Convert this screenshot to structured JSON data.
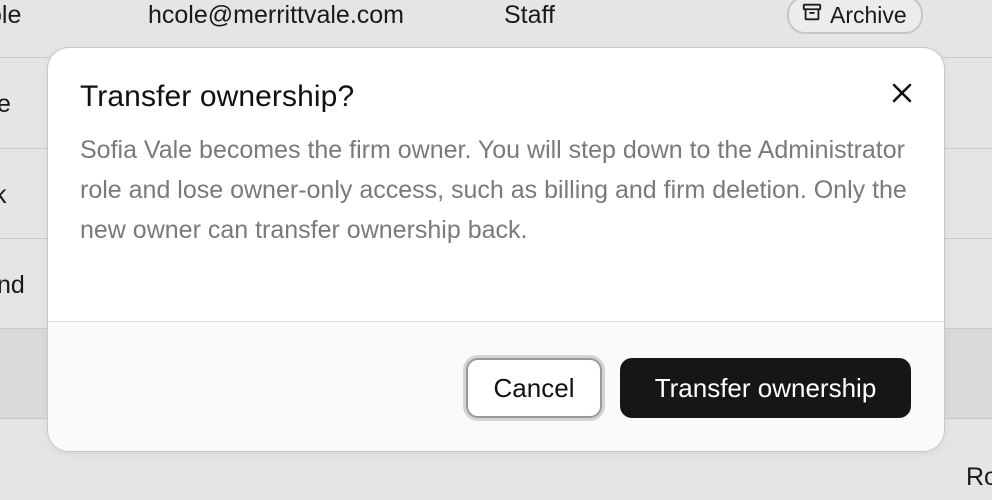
{
  "background_table": {
    "rows": [
      {
        "name_fragment": "ole",
        "email": "hcole@merrittvale.com",
        "role": "Staff",
        "action_label": "Archive"
      },
      {
        "name_fragment": "e"
      },
      {
        "name_fragment": "k"
      },
      {
        "name_fragment": "nd"
      },
      {
        "name_fragment": ""
      },
      {
        "trailing_fragment": "Ro"
      }
    ]
  },
  "dialog": {
    "title": "Transfer ownership?",
    "body": "Sofia Vale becomes the firm owner. You will step down to the Administrator role and lose owner-only access, such as billing and firm deletion. Only the new owner can transfer ownership back.",
    "cancel_label": "Cancel",
    "confirm_label": "Transfer ownership"
  },
  "icons": {
    "archive": "archive-box-icon",
    "close": "close-icon"
  },
  "colors": {
    "primary_button": "#161616",
    "body_text": "#7a7a7a",
    "backdrop": "#dcdcdc"
  }
}
